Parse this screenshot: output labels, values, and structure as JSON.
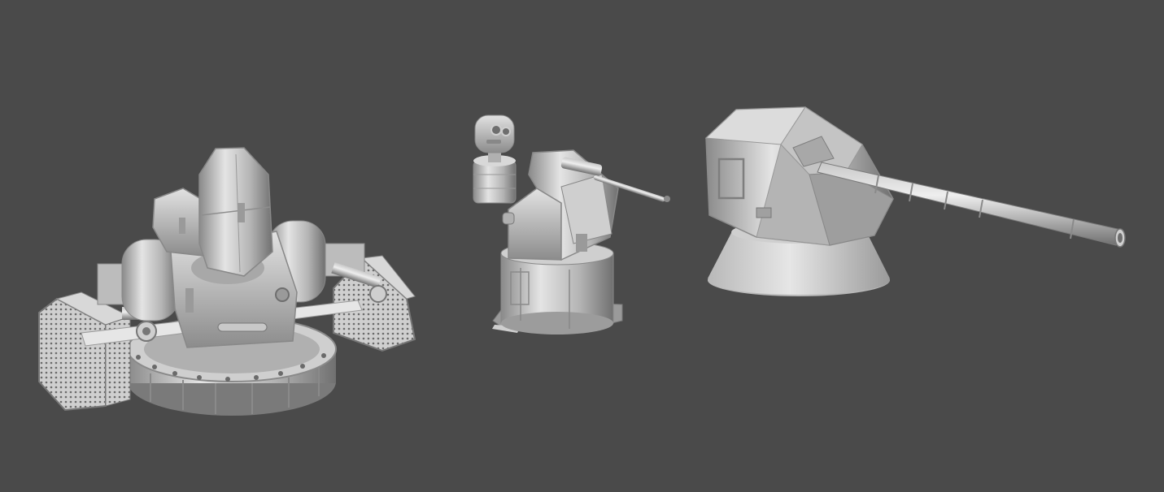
{
  "scene": {
    "background": "#4a4a4a",
    "material_light": "#d6d6d6",
    "material_mid": "#a8a8a8",
    "material_dark": "#6e6e6e",
    "objects": [
      {
        "name": "missile-launcher-turret"
      },
      {
        "name": "remote-weapon-station"
      },
      {
        "name": "naval-gun-turret"
      }
    ]
  }
}
